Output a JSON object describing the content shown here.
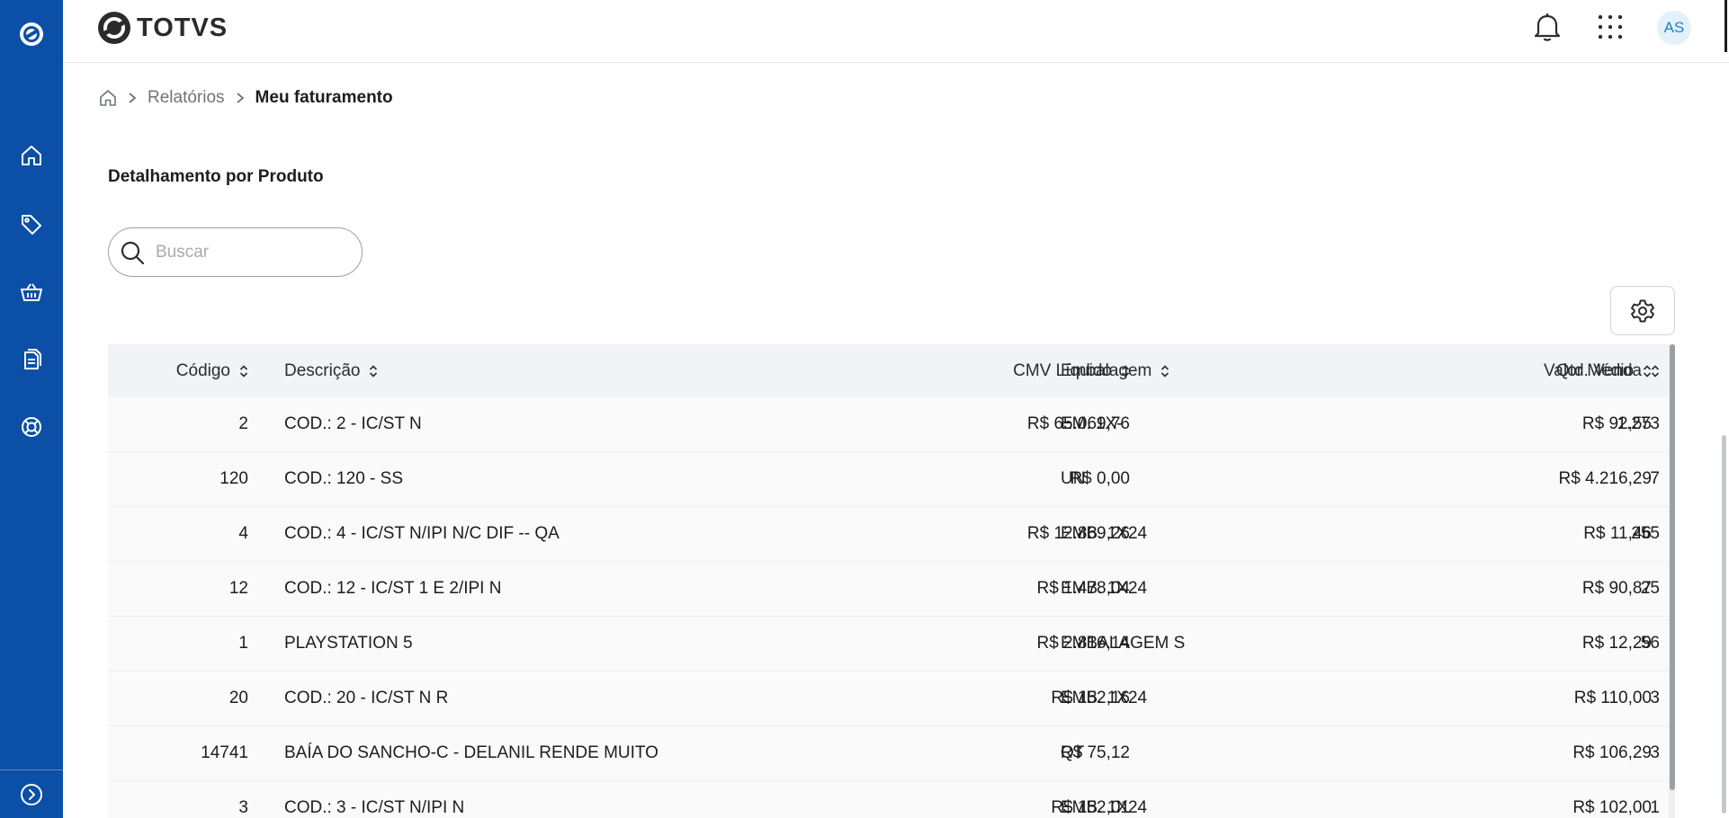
{
  "app": {
    "brand_name": "TOTVS",
    "avatar_initials": "AS",
    "colors": {
      "rail": "#0b4fa6",
      "accent": "#1b84c4",
      "header_row": "#f1f3f6"
    }
  },
  "rail": {
    "items": [
      {
        "name": "logo",
        "icon": "totvs-logo-icon"
      },
      {
        "name": "home",
        "icon": "home-icon"
      },
      {
        "name": "tags",
        "icon": "tag-icon"
      },
      {
        "name": "basket",
        "icon": "basket-icon"
      },
      {
        "name": "documents",
        "icon": "documents-icon"
      },
      {
        "name": "support",
        "icon": "lifebuoy-icon"
      },
      {
        "name": "expand",
        "icon": "chevron-right-circle-icon"
      }
    ]
  },
  "header": {
    "icons": [
      "bell-icon",
      "apps-grid-icon"
    ]
  },
  "breadcrumb": {
    "home_icon": "home-icon",
    "items": [
      {
        "label": "Relatórios"
      },
      {
        "label": "Meu faturamento"
      }
    ]
  },
  "section": {
    "title": "Detalhamento por Produto"
  },
  "search": {
    "placeholder": "Buscar",
    "value": ""
  },
  "table": {
    "columns": [
      {
        "key": "codigo",
        "label": "Código"
      },
      {
        "key": "descricao",
        "label": "Descrição"
      },
      {
        "key": "cmv",
        "label": "CMV Líquido"
      },
      {
        "key": "embalagem",
        "label": "Embalagem"
      },
      {
        "key": "qtd",
        "label": "Qtd. Venda"
      },
      {
        "key": "valor",
        "label": "Valor Médio"
      }
    ],
    "rows": [
      {
        "codigo": "2",
        "descricao": "COD.: 2 - IC/ST N",
        "cmv": "R$ 65.069,76",
        "embalagem": "EM. 1X-",
        "qtd": "1.273",
        "valor": "R$ 92,55"
      },
      {
        "codigo": "120",
        "descricao": "COD.: 120 - SS",
        "cmv": "R$ 0,00",
        "embalagem": "UN",
        "qtd": "7",
        "valor": "R$ 4.216,29"
      },
      {
        "codigo": "4",
        "descricao": "COD.: 4 - IC/ST N/IPI N/C DIF -- QA",
        "cmv": "R$ 12.869,26",
        "embalagem": "EMB. 1X24",
        "qtd": "255",
        "valor": "R$ 11,46"
      },
      {
        "codigo": "12",
        "descricao": "COD.: 12 - IC/ST 1 E 2/IPI N",
        "cmv": "R$ 1.478,04",
        "embalagem": "EMB. 1X24",
        "qtd": "25",
        "valor": "R$ 90,87"
      },
      {
        "codigo": "1",
        "descricao": "PLAYSTATION 5",
        "cmv": "R$ 2.816,14",
        "embalagem": "EMBALAGEM S",
        "qtd": "56",
        "valor": "R$ 12,29"
      },
      {
        "codigo": "20",
        "descricao": "COD.: 20 - IC/ST N R",
        "cmv": "R$ 152,16",
        "embalagem": "EMB. 1X24",
        "qtd": "3",
        "valor": "R$ 110,00"
      },
      {
        "codigo": "14741",
        "descricao": "BAÍA DO SANCHO-C - DELANIL RENDE MUITO",
        "cmv": "R$ 75,12",
        "embalagem": "QT",
        "qtd": "3",
        "valor": "R$ 106,29"
      },
      {
        "codigo": "3",
        "descricao": "COD.: 3 - IC/ST N/IPI N",
        "cmv": "R$ 152,01",
        "embalagem": "EMB. 1X24",
        "qtd": "1",
        "valor": "R$ 102,00"
      }
    ]
  }
}
